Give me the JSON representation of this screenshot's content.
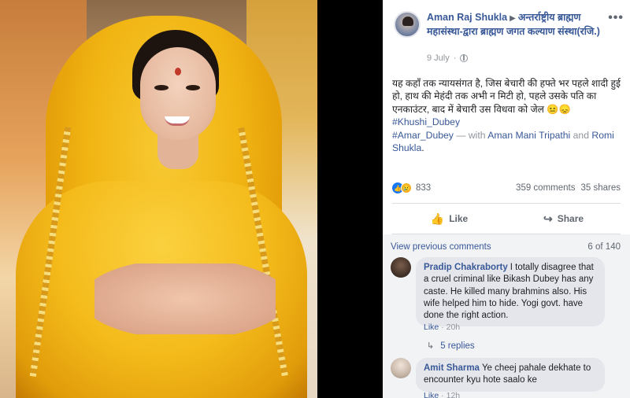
{
  "post": {
    "author": "Aman Raj Shukla",
    "arrow": "▶",
    "group": "अन्तर्राष्ट्रीय ब्राह्मण महासंस्था-द्वारा ब्राह्मण जगत कल्याण संस्था(रजि.)",
    "date": "9 July",
    "more": "•••",
    "text_body": "यह कहाँ तक न्यायसंगत है, जिस बेचारी की हफ्ते भर पहले शादी हुई हो, हाथ की मेहंदी तक अभी न मिटी हो, पहले उसके पति का एनकाउंटर, बाद में बेचारी उस विधवा को जेल 😐😞",
    "hashtag1": "#Khushi_Dubey",
    "hashtag2": "#Amar_Dubey",
    "with_text": "— with",
    "tagged1": "Aman Mani Tripathi",
    "and_text": "and",
    "tagged2": "Romi Shukla",
    "end_dot": "."
  },
  "stats": {
    "reaction_count": "833",
    "comments": "359 comments",
    "shares": "35 shares",
    "like_icon": "👍",
    "sad_icon": "😢"
  },
  "actions": {
    "like_label": "Like",
    "share_label": "Share",
    "like_icon": "👍",
    "share_icon": "↪"
  },
  "comments": {
    "view_previous": "View previous comments",
    "count": "6 of 140",
    "items": [
      {
        "name": "Pradip Chakraborty",
        "text": "I totally disagree that a cruel criminal like Bikash Dubey has any caste. He killed many brahmins also. His wife helped him to hide. Yogi govt. have done the right action.",
        "like": "Like",
        "sep": " · ",
        "time": "20h",
        "replies": "5 replies",
        "replies_arrow": "↳"
      },
      {
        "name": "Amit Sharma",
        "text": "Ye cheej pahale dekhate to encounter kyu hote saalo ke",
        "like": "Like",
        "sep": " · ",
        "time": "12h"
      }
    ]
  },
  "colors": {
    "link": "#385898",
    "like_blue": "#1877f2",
    "panel_bg": "#ffffff",
    "comment_bg": "#f2f3f5"
  }
}
